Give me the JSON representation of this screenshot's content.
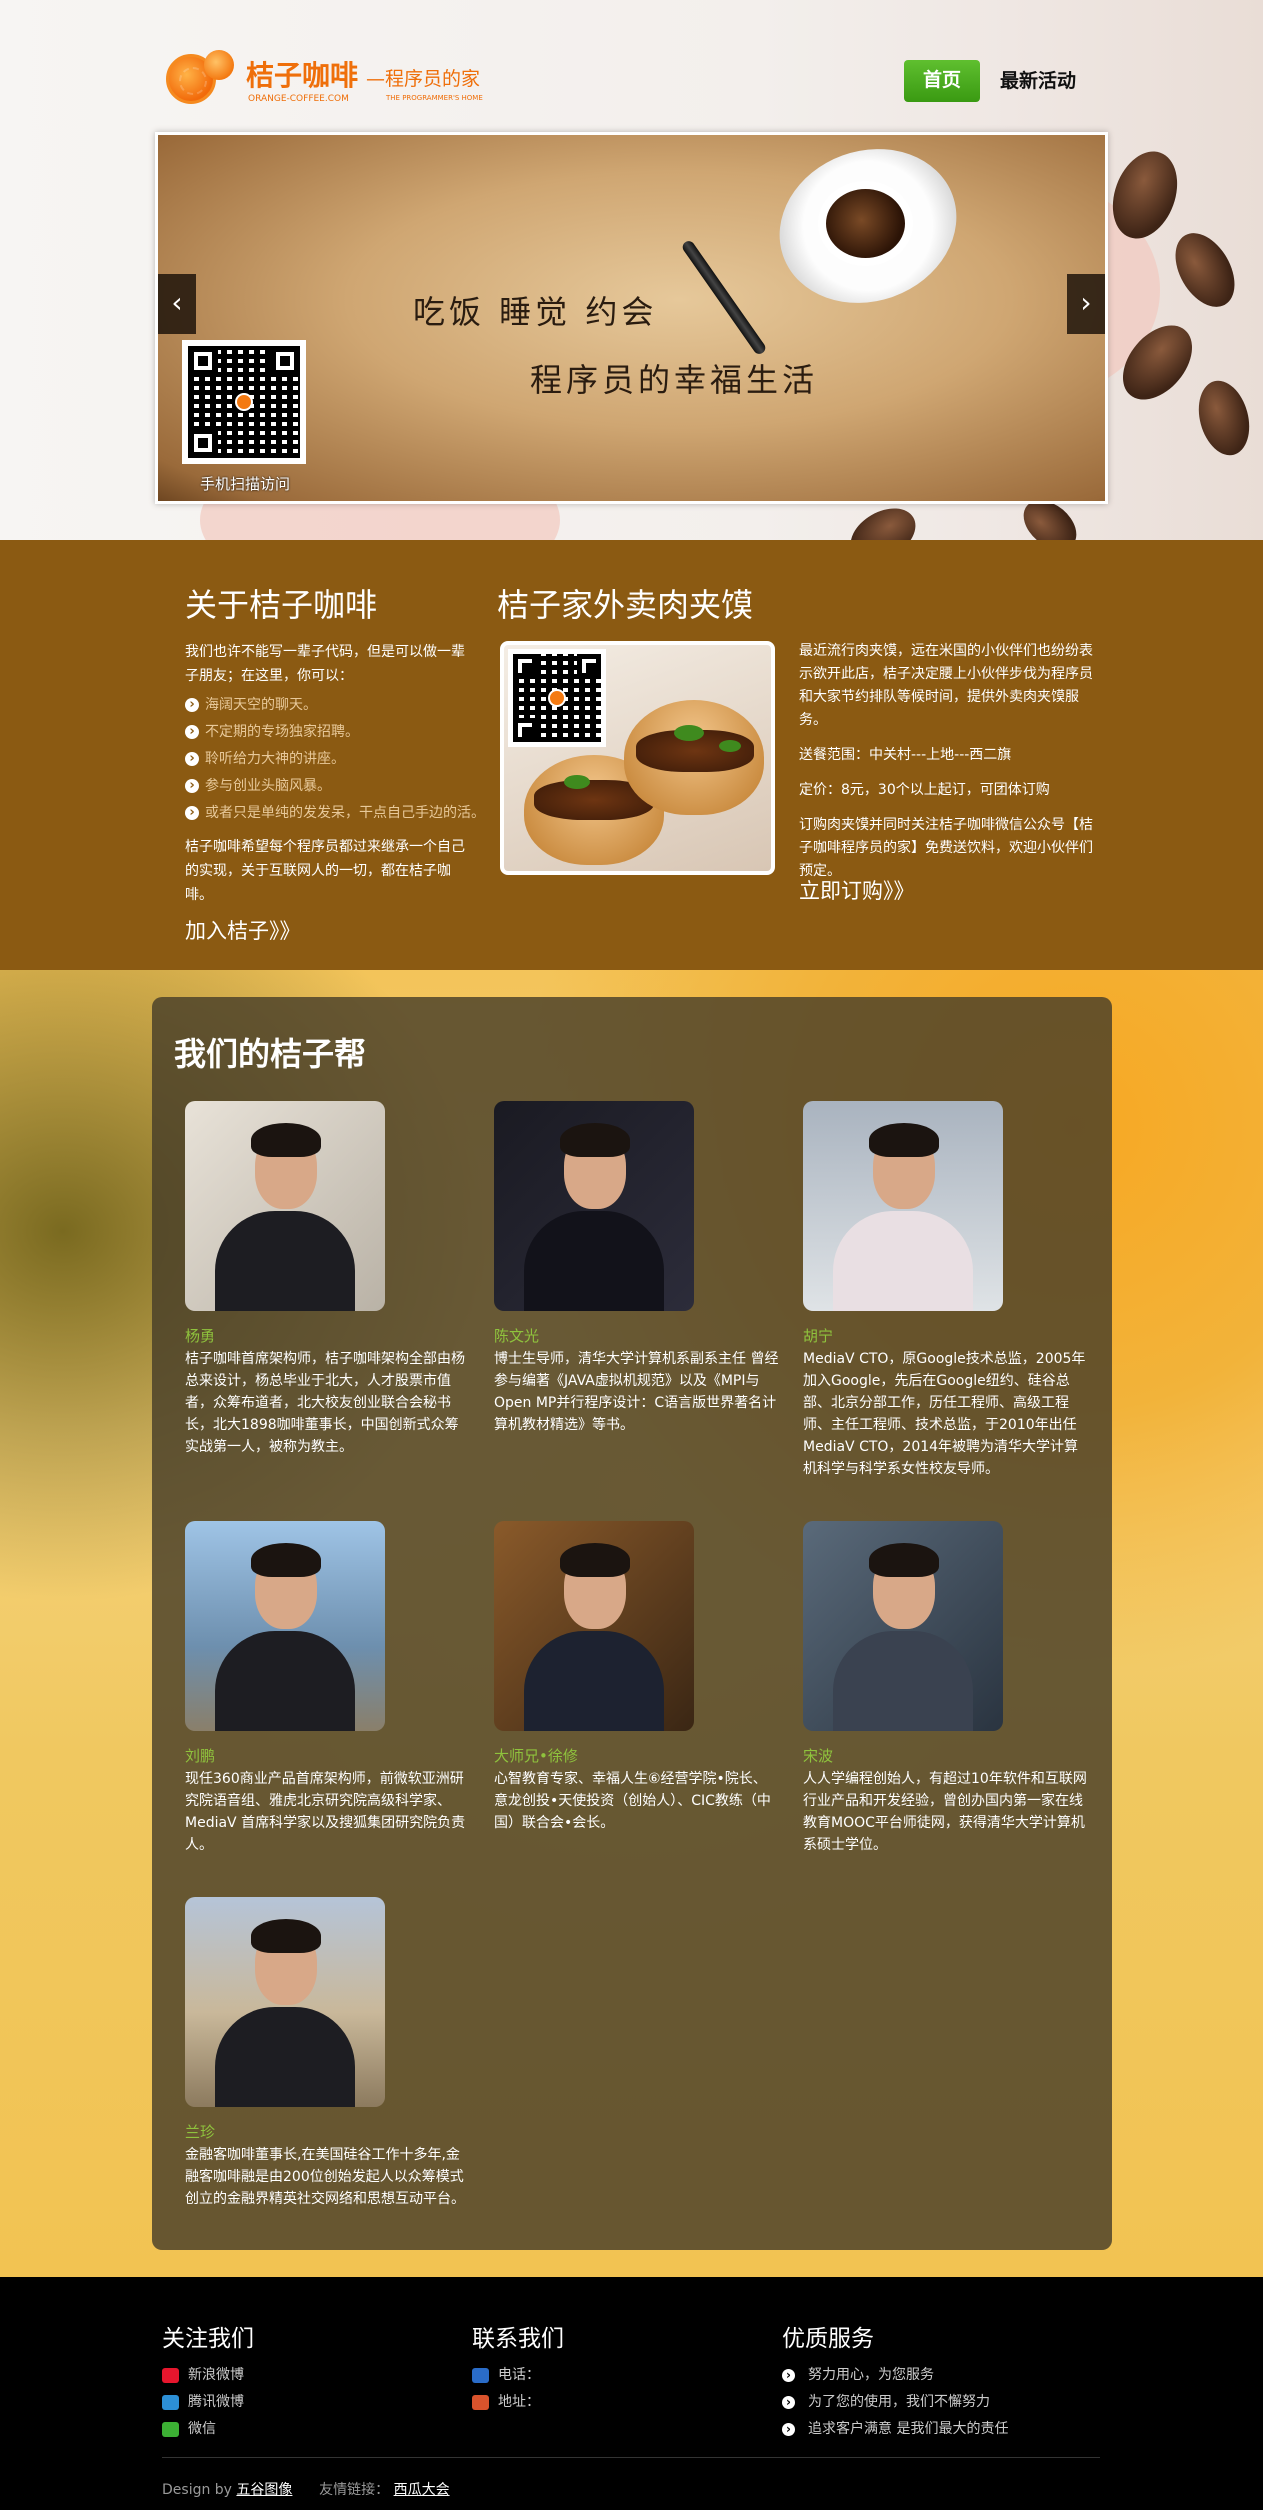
{
  "header": {
    "logo_cn": "桔子咖啡",
    "logo_sub": "—程序员的家",
    "logo_en": "ORANGE-COFFEE.COM",
    "logo_en2": "THE PROGRAMMER'S HOME",
    "nav": {
      "home": "首页",
      "events": "最新活动"
    }
  },
  "banner": {
    "line1": "吃饭 睡觉 约会",
    "line2": "程序员的幸福生活",
    "qr_caption": "手机扫描访问",
    "prev": "‹",
    "next": "›"
  },
  "about": {
    "title": "关于桔子咖啡",
    "intro": "我们也许不能写一辈子代码，但是可以做一辈子朋友；在这里，你可以：",
    "items": [
      "海阔天空的聊天。",
      "不定期的专场独家招聘。",
      "聆听给力大神的讲座。",
      "参与创业头脑风暴。",
      "或者只是单纯的发发呆，干点自己手边的活。"
    ],
    "outro": "桔子咖啡希望每个程序员都过来继承一个自己的实现，关于互联网人的一切，都在桔子咖啡。",
    "join": "加入桔子》》"
  },
  "food": {
    "title": "桔子家外卖肉夹馍",
    "paragraphs": [
      "最近流行肉夹馍，远在米国的小伙伴们也纷纷表示欲开此店，桔子决定腰上小伙伴步伐为程序员和大家节约排队等候时间，提供外卖肉夹馍服务。",
      "送餐范围：中关村---上地---西二旗",
      "定价：8元，30个以上起订，可团体订购",
      "订购肉夹馍并同时关注桔子咖啡微信公众号【桔子咖啡程序员的家】免费送饮料，欢迎小伙伴们预定。"
    ],
    "order": "立即订购》》"
  },
  "team": {
    "title": "我们的桔子帮",
    "members": [
      {
        "name": "杨勇",
        "desc": "桔子咖啡首席架构师，桔子咖啡架构全部由杨总来设计，杨总毕业于北大，人才股票市值者，众筹布道者，北大校友创业联合会秘书长，北大1898咖啡董事长，中国创新式众筹实战第一人，被称为教主。"
      },
      {
        "name": "陈文光",
        "desc": "博士生导师，清华大学计算机系副系主任 曾经参与编著《JAVA虚拟机规范》以及《MPI与Open MP并行程序设计：C语言版世界著名计算机教材精选》等书。"
      },
      {
        "name": "胡宁",
        "desc": "MediaV CTO，原Google技术总监，2005年加入Google，先后在Google纽约、硅谷总部、北京分部工作，历任工程师、高级工程师、主任工程师、技术总监，于2010年出任MediaV CTO，2014年被聘为清华大学计算机科学与科学系女性校友导师。"
      },
      {
        "name": "刘鹏",
        "desc": "现任360商业产品首席架构师，前微软亚洲研究院语音组、雅虎北京研究院高级科学家、MediaV 首席科学家以及搜狐集团研究院负责人。"
      },
      {
        "name": "大师兄•徐修",
        "desc": "心智教育专家、幸福人生⑥经营学院•院长、意龙创投•天使投资（创始人）、CIC教练（中国）联合会•会长。"
      },
      {
        "name": "宋波",
        "desc": "人人学编程创始人，有超过10年软件和互联网行业产品和开发经验，曾创办国内第一家在线教育MOOC平台师徒网，获得清华大学计算机系硕士学位。"
      },
      {
        "name": "兰珍",
        "desc": "金融客咖啡董事长,在美国硅谷工作十多年,金融客咖啡融是由200位创始发起人以众筹模式创立的金融界精英社交网络和思想互动平台。"
      }
    ]
  },
  "footer": {
    "follow": {
      "title": "关注我们",
      "items": [
        "新浪微博",
        "腾讯微博",
        "微信"
      ]
    },
    "contact": {
      "title": "联系我们",
      "items": [
        "电话：",
        "地址："
      ]
    },
    "service": {
      "title": "优质服务",
      "items": [
        "努力用心，为您服务",
        "为了您的使用，我们不懈努力",
        "追求客户满意 是我们最大的责任"
      ]
    },
    "design_by": "Design by",
    "designer": "五谷图像",
    "links_label": "友情链接：",
    "link": "西瓜大会"
  },
  "colors": {
    "brown": "#8b5a12",
    "green": "#3a9a12",
    "orange": "#ef6f0a",
    "name_green": "#8fc33d"
  }
}
